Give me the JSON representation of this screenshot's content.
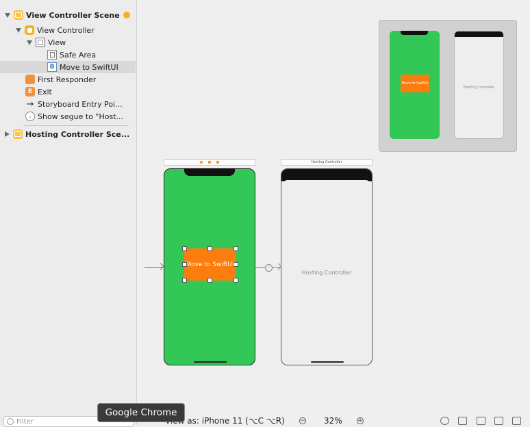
{
  "outline": {
    "items": [
      {
        "label": "View Controller Scene"
      },
      {
        "label": "View Controller"
      },
      {
        "label": "View"
      },
      {
        "label": "Safe Area"
      },
      {
        "label": "Move to SwiftUI"
      },
      {
        "label": "First Responder"
      },
      {
        "label": "Exit"
      },
      {
        "label": "Storyboard Entry Poi..."
      },
      {
        "label": "Show segue to \"Host..."
      },
      {
        "label": "Hosting Controller Sce..."
      }
    ],
    "button_icon_glyph": "B",
    "exit_icon_glyph": "E",
    "filter_placeholder": "Filter"
  },
  "canvas": {
    "button_label": "Move to SwiftUI",
    "hosting_title": "Hosting Controller",
    "hosting_label": "Hosting Controller",
    "minimap_button_label": "Move to SwiftUI",
    "minimap_hosting_label": "Hosting Controller"
  },
  "tooltip": "Google Chrome",
  "bottombar": {
    "view_as": "View as: iPhone 11 (⌥C ⌥R)",
    "zoom": "32%",
    "zoom_out": "−",
    "zoom_in": "+"
  },
  "colors": {
    "scene_green": "#33c758",
    "button_orange": "#fb7d0e",
    "scene_icon": "#f6b21b"
  }
}
